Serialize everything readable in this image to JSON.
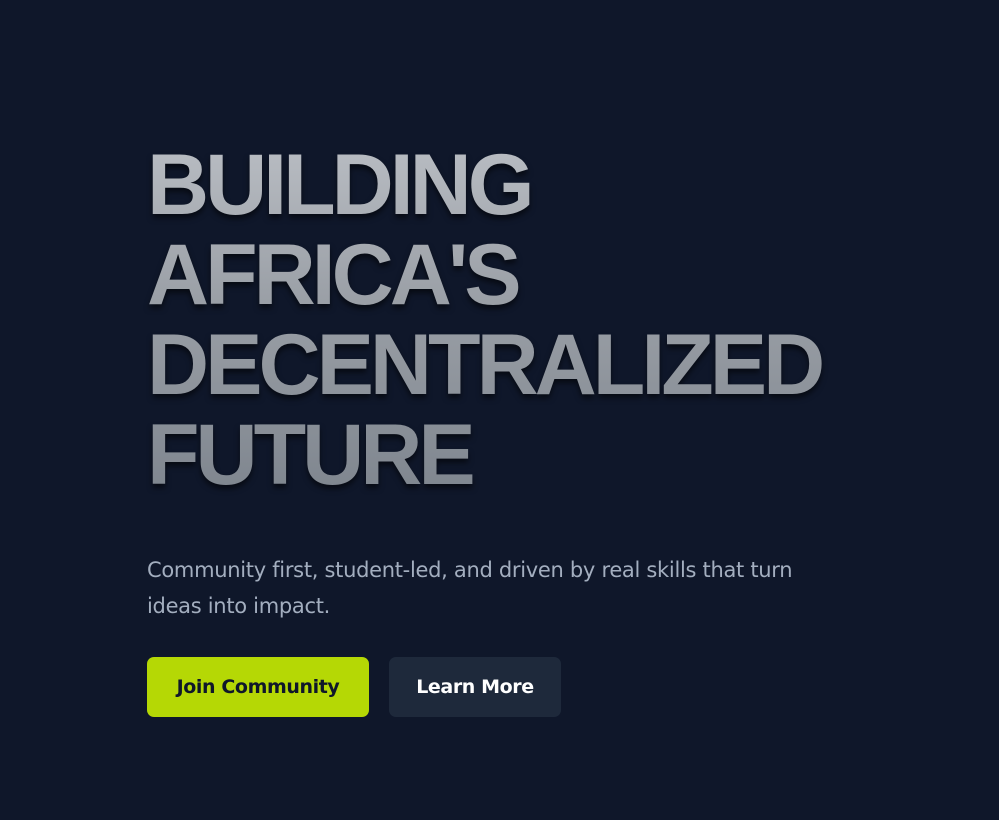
{
  "hero": {
    "headline_lines": [
      "BUILDING",
      "AFRICA'S",
      "DECENTRALIZED",
      "FUTURE"
    ],
    "subtitle": "Community first, student-led, and driven by real skills that turn ideas into impact."
  },
  "actions": {
    "primary_label": "Join Community",
    "secondary_label": "Learn More"
  },
  "colors": {
    "background": "#0f172a",
    "accent": "#b5d805",
    "secondary_button": "#1e293b",
    "subtitle_text": "#a3aebf"
  }
}
